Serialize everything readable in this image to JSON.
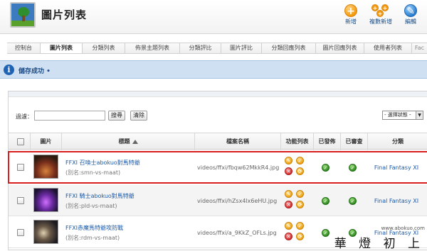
{
  "header": {
    "title": "圖片列表",
    "tools": [
      {
        "label": "新增",
        "icon": "add-icon"
      },
      {
        "label": "複數新增",
        "icon": "multi-add-icon"
      },
      {
        "label": "編輯",
        "icon": "edit-icon"
      }
    ]
  },
  "tabs": [
    "控制台",
    "圖片列表",
    "分類列表",
    "佈景主題列表",
    "分類評比",
    "圖片評比",
    "分類回應列表",
    "圖片回應列表",
    "使用者列表",
    "Fac"
  ],
  "active_tab": "圖片列表",
  "message": {
    "text": "儲存成功",
    "icon": "info-icon"
  },
  "filter": {
    "label": "過濾：",
    "input_value": "",
    "search_button": "搜尋",
    "clear_button": "清除",
    "status_select": "- 選擇狀態 -"
  },
  "table": {
    "columns": [
      "圖片",
      "標題",
      "檔案名稱",
      "功能列表",
      "已發佈",
      "已審查",
      "分類"
    ],
    "rows": [
      {
        "title": "FFXI 召喚士abokuo對馬特爺",
        "alias": "(別名:smn-vs-maat)",
        "filename": "videos/ffxi/fbqw62MkkR4.jpg",
        "category": "Final Fantasy XI",
        "published": true,
        "reviewed": true,
        "highlighted": true
      },
      {
        "title": "FFXI 騎士abokuo對馬特爺",
        "alias": "(別名:pld-vs-maat)",
        "filename": "videos/ffxi/hZsx4lx6eHU.jpg",
        "category": "Final Fantasy XI",
        "published": true,
        "reviewed": true,
        "highlighted": false
      },
      {
        "title": "FFXI赤魔馬特爺攻防戰",
        "alias": "(別名:rdm-vs-maat)",
        "filename": "videos/ffxi/a_9KkZ_OFLs.jpg",
        "category": "Final Fantasy XI",
        "published": true,
        "reviewed": true,
        "highlighted": false
      }
    ]
  },
  "watermark": {
    "url": "www.abokuo.com",
    "text": "華 燈 初 上"
  }
}
